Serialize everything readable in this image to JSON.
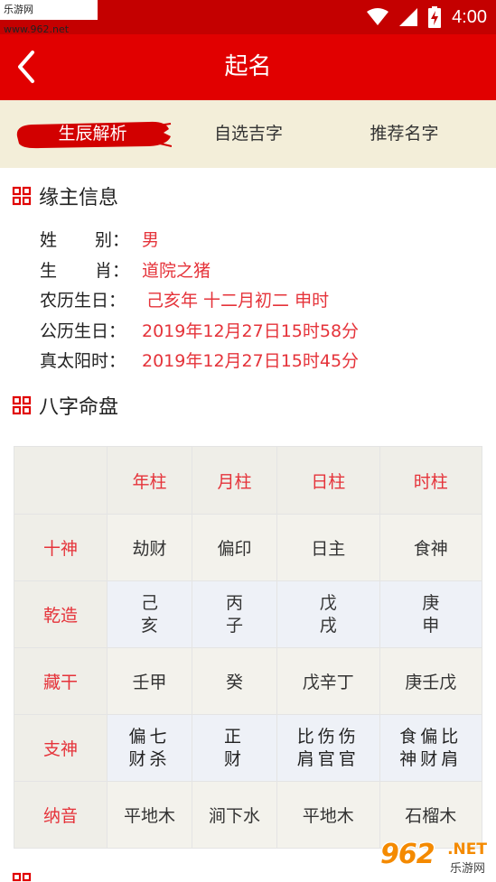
{
  "status_bar": {
    "watermark": "乐游网 www.962.net",
    "time": "4:00"
  },
  "header": {
    "title": "起名"
  },
  "tabs": [
    {
      "label": "生辰解析",
      "active": true
    },
    {
      "label": "自选吉字",
      "active": false
    },
    {
      "label": "推荐名字",
      "active": false
    }
  ],
  "section_info": {
    "title": "缘主信息",
    "rows": [
      {
        "label": "姓　别",
        "value": "男"
      },
      {
        "label": "生　肖",
        "value": "道院之猪"
      },
      {
        "label": "农历生日",
        "value": "己亥年 十二月初二 申时"
      },
      {
        "label": "公历生日",
        "value": "2019年12月27日15时58分"
      },
      {
        "label": "真太阳时",
        "value": "2019年12月27日15时45分"
      }
    ],
    "label_parts": {
      "gender_a": "姓",
      "gender_b": "别",
      "zodiac_a": "生",
      "zodiac_b": "肖"
    },
    "colon": "："
  },
  "section_bazi": {
    "title": "八字命盘",
    "columns": [
      "年柱",
      "月柱",
      "日柱",
      "时柱"
    ],
    "rows": [
      {
        "label": "十神",
        "cells": [
          "劫财",
          "偏印",
          "日主",
          "食神"
        ]
      },
      {
        "label": "乾造",
        "cells": [
          [
            "己",
            "亥"
          ],
          [
            "丙",
            "子"
          ],
          [
            "戊",
            "戌"
          ],
          [
            "庚",
            "申"
          ]
        ]
      },
      {
        "label": "藏干",
        "cells": [
          "壬甲",
          "癸",
          "戊辛丁",
          "庚壬戊"
        ]
      },
      {
        "label": "支神",
        "cells": [
          [
            "偏七",
            "财杀"
          ],
          [
            "正",
            "财"
          ],
          [
            "比伤伤",
            "肩官官"
          ],
          [
            "食偏比",
            "神财肩"
          ]
        ]
      },
      {
        "label": "纳音",
        "cells": [
          "平地木",
          "涧下水",
          "平地木",
          "石榴木"
        ]
      }
    ]
  },
  "colors": {
    "brand_red": "#e10000",
    "status_red": "#c40000",
    "value_red": "#e5333a",
    "tab_bg": "#f3eed9"
  },
  "watermark": {
    "number": "962",
    "net": ".NET",
    "cn": "乐游网"
  }
}
